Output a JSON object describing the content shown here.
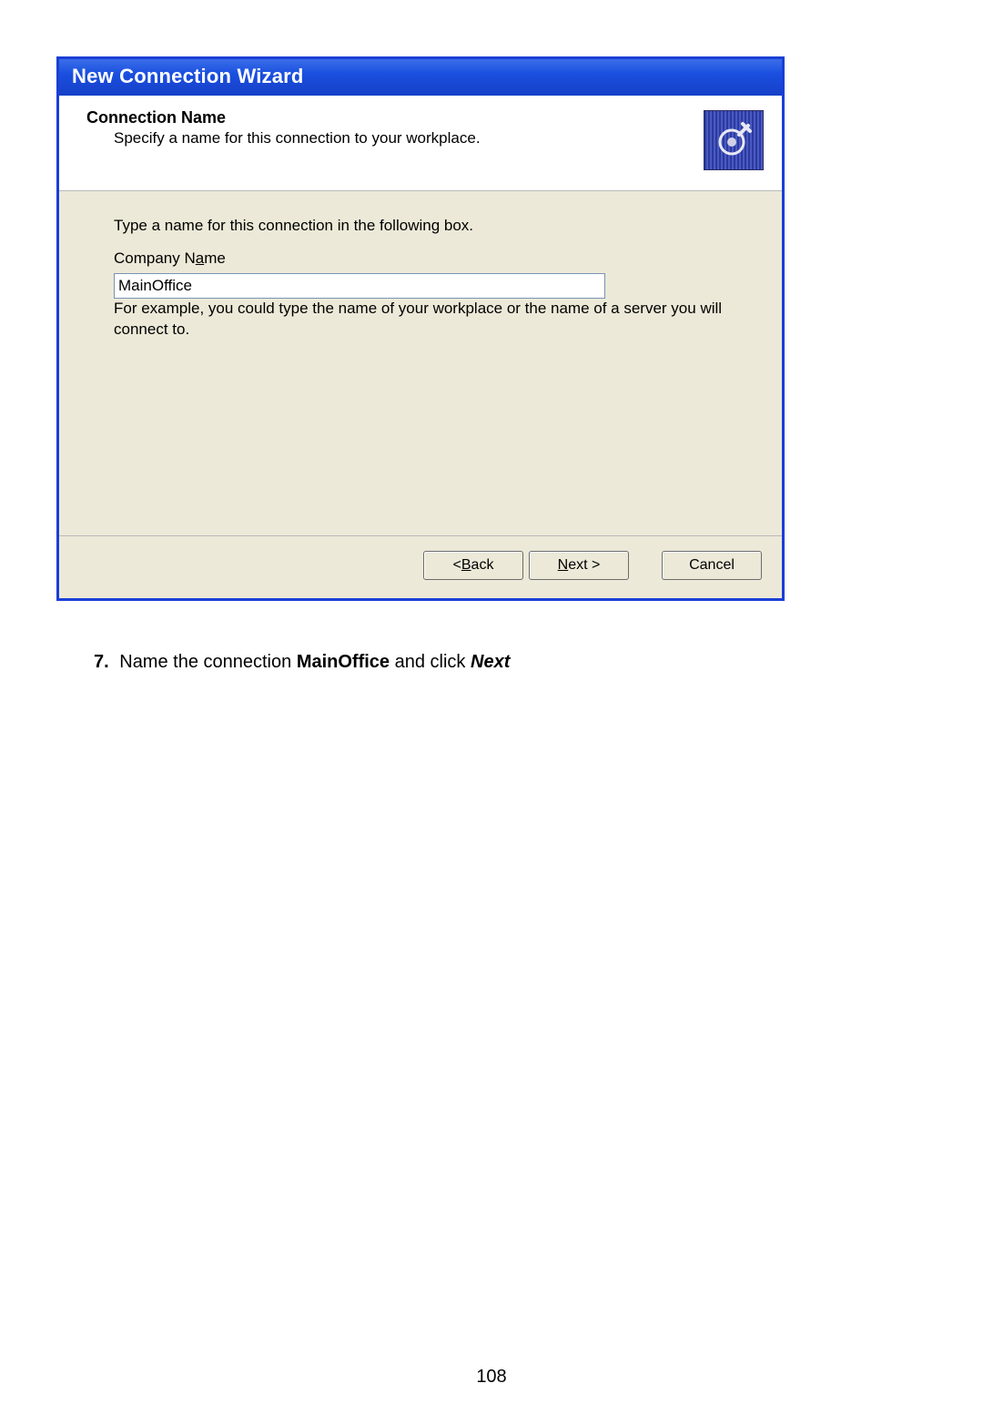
{
  "dialog": {
    "title": "New Connection Wizard",
    "header": {
      "title": "Connection Name",
      "subtitle": "Specify a name for this connection to your workplace.",
      "icon": "connection-icon"
    },
    "body": {
      "instruction": "Type a name for this connection in the following box.",
      "label_pre": "Company N",
      "label_key": "a",
      "label_post": "me",
      "input_value": "MainOffice",
      "hint": "For example, you could type the name of your workplace or the name of a server you will connect to."
    },
    "buttons": {
      "back_pre": "< ",
      "back_key": "B",
      "back_post": "ack",
      "next_key": "N",
      "next_post": "ext >",
      "cancel": "Cancel"
    }
  },
  "doc": {
    "step_number": "7.",
    "step_pre": " Name the connection ",
    "step_bold": "MainOffice",
    "step_mid": " and click ",
    "step_action": "Next",
    "page_number": "108"
  }
}
